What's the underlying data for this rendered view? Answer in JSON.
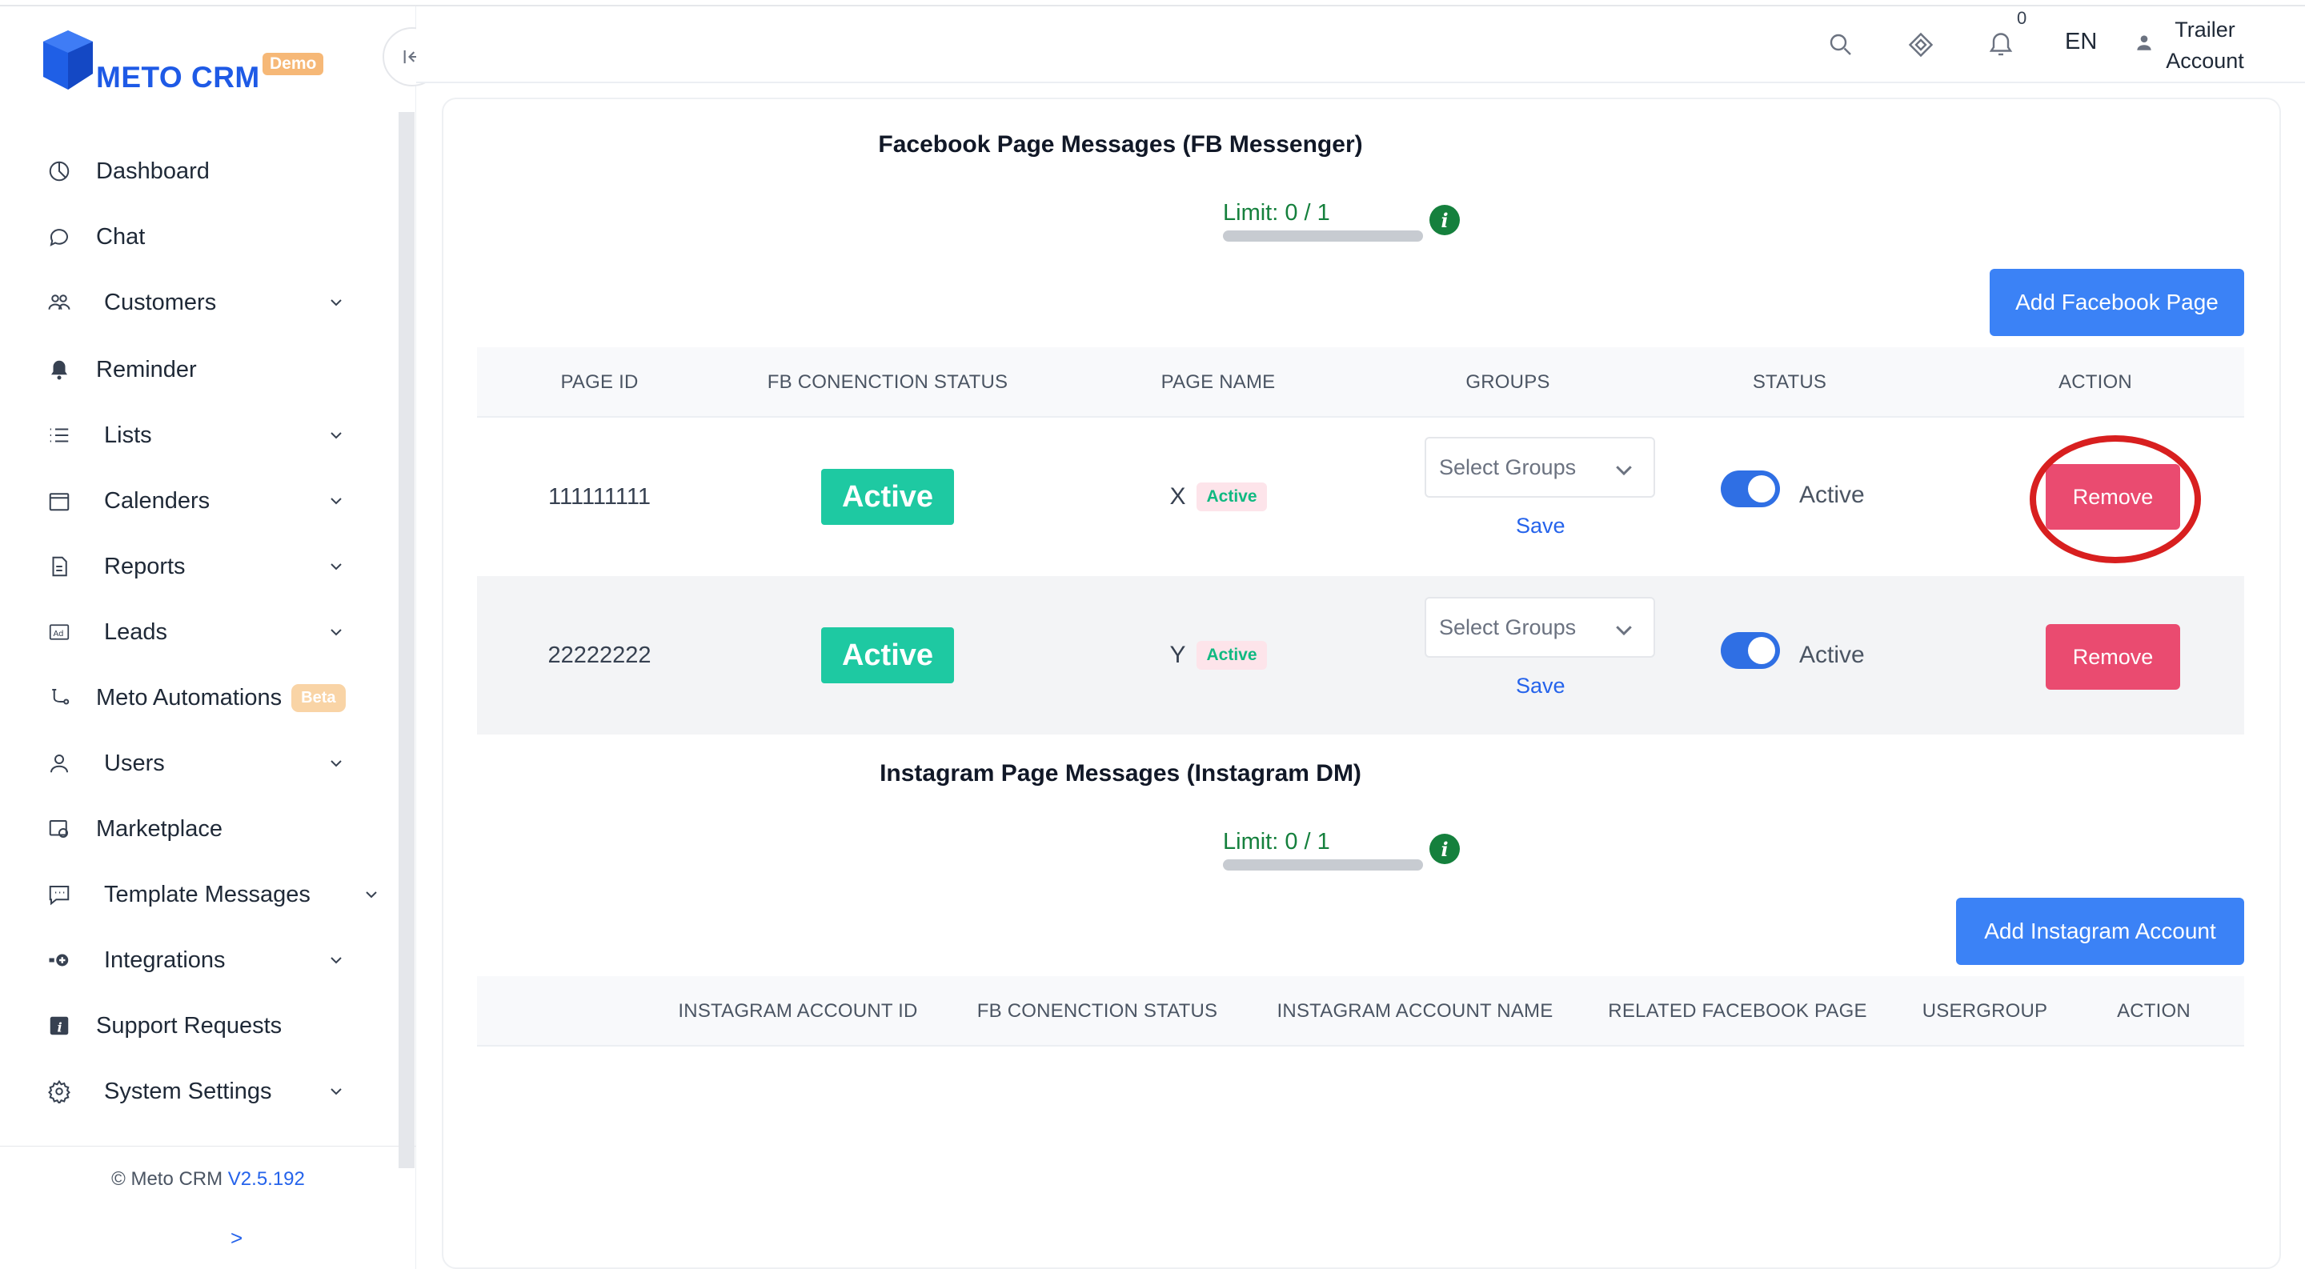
{
  "brand": {
    "name": "METO CRM",
    "badge": "Demo"
  },
  "sidebar": {
    "items": [
      {
        "label": "Dashboard",
        "icon": "dashboard-icon",
        "has_children": false
      },
      {
        "label": "Chat",
        "icon": "chat-icon",
        "has_children": false
      },
      {
        "label": "Customers",
        "icon": "customers-icon",
        "has_children": true
      },
      {
        "label": "Reminder",
        "icon": "bell-icon",
        "has_children": false
      },
      {
        "label": "Lists",
        "icon": "list-icon",
        "has_children": true
      },
      {
        "label": "Calenders",
        "icon": "calendar-icon",
        "has_children": true
      },
      {
        "label": "Reports",
        "icon": "report-icon",
        "has_children": true
      },
      {
        "label": "Leads",
        "icon": "ad-icon",
        "has_children": true
      },
      {
        "label": "Meto Automations",
        "icon": "automation-icon",
        "has_children": false,
        "badge": "Beta"
      },
      {
        "label": "Users",
        "icon": "user-icon",
        "has_children": true
      },
      {
        "label": "Marketplace",
        "icon": "marketplace-icon",
        "has_children": false
      },
      {
        "label": "Template Messages",
        "icon": "template-icon",
        "has_children": true
      },
      {
        "label": "Integrations",
        "icon": "integrations-icon",
        "has_children": true
      },
      {
        "label": "Support Requests",
        "icon": "info-icon",
        "has_children": false
      },
      {
        "label": "System Settings",
        "icon": "gear-icon",
        "has_children": true
      }
    ],
    "footer": {
      "copyright": "© Meto CRM",
      "version": "V2.5.192",
      "expand": ">"
    }
  },
  "header": {
    "notification_count": "0",
    "language": "EN",
    "account_line1": "Trailer",
    "account_line2": "Account"
  },
  "facebook": {
    "title": "Facebook Page Messages (FB Messenger)",
    "limit": "Limit: 0 / 1",
    "limit_used": 0,
    "limit_total": 1,
    "add_button": "Add Facebook Page",
    "columns": [
      "PAGE ID",
      "FB CONENCTION STATUS",
      "PAGE NAME",
      "GROUPS",
      "STATUS",
      "ACTION"
    ],
    "rows": [
      {
        "page_id": "111111111",
        "connection": "Active",
        "page_name": "X",
        "page_badge": "Active",
        "groups_placeholder": "Select Groups",
        "save": "Save",
        "status": "Active",
        "action": "Remove"
      },
      {
        "page_id": "22222222",
        "connection": "Active",
        "page_name": "Y",
        "page_badge": "Active",
        "groups_placeholder": "Select Groups",
        "save": "Save",
        "status": "Active",
        "action": "Remove"
      }
    ]
  },
  "instagram": {
    "title": "Instagram Page Messages (Instagram DM)",
    "limit": "Limit: 0 / 1",
    "limit_used": 0,
    "limit_total": 1,
    "add_button": "Add Instagram Account",
    "columns": [
      "INSTAGRAM ACCOUNT ID",
      "FB CONENCTION STATUS",
      "INSTAGRAM ACCOUNT NAME",
      "RELATED FACEBOOK PAGE",
      "USERGROUP",
      "ACTION"
    ]
  },
  "colors": {
    "primary": "#3b82f6",
    "danger": "#ea4b70",
    "success": "#1ec9a2",
    "limit": "#15803d",
    "highlight_ring": "#d81f1f"
  }
}
